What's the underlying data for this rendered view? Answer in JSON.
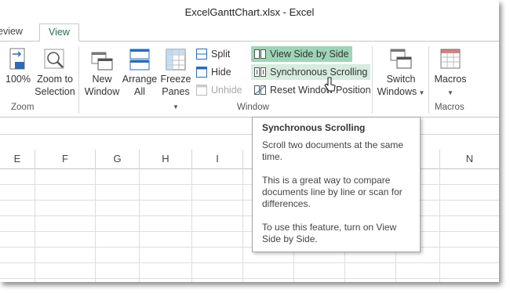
{
  "window": {
    "title": "ExcelGanttChart.xlsx - Excel"
  },
  "tabs": [
    {
      "label": "Review",
      "visible": "eview"
    },
    {
      "label": "View"
    }
  ],
  "ribbon": {
    "zoom_group": {
      "label": "Zoom",
      "hundred": [
        "100%"
      ],
      "zoom_to_selection": [
        "Zoom to",
        "Selection"
      ]
    },
    "window_group": {
      "label": "Window",
      "new_window": [
        "New",
        "Window"
      ],
      "arrange_all": [
        "Arrange",
        "All"
      ],
      "freeze_panes": [
        "Freeze",
        "Panes"
      ],
      "split": "Split",
      "hide": "Hide",
      "unhide": "Unhide",
      "view_side_by_side": "View Side by Side",
      "synchronous_scrolling": "Synchronous Scrolling",
      "reset_window_position": "Reset Window Position",
      "switch_windows": [
        "Switch",
        "Windows"
      ]
    },
    "macros_group": {
      "label": "Macros",
      "macros": [
        "Macros"
      ]
    }
  },
  "columns": [
    "E",
    "F",
    "G",
    "H",
    "I",
    "",
    "",
    "",
    "",
    "N"
  ],
  "tooltip": {
    "title": "Synchronous Scrolling",
    "line1": "Scroll two documents at the same time.",
    "line2": "This is a great way to compare documents line by line or scan for differences.",
    "line3": "To use this feature, turn on View Side by Side."
  },
  "colors": {
    "accent": "#217346",
    "highlight_strong": "#9fd5b7",
    "highlight_soft": "#d7ece0"
  }
}
